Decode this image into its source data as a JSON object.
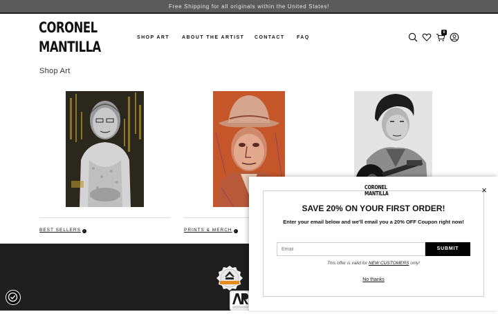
{
  "announcement": "Free Shipping for all originals within the United States!",
  "logo": {
    "line1": "CORONEL",
    "line2": "MANTILLA"
  },
  "nav": [
    {
      "label": "SHOP ART"
    },
    {
      "label": "ABOUT THE ARTIST"
    },
    {
      "label": "CONTACT"
    },
    {
      "label": "FAQ"
    }
  ],
  "header_icons": [
    "search-icon",
    "heart-icon",
    "cart-icon",
    "account-icon"
  ],
  "cart_count": "0",
  "page_title": "Shop Art",
  "categories": [
    {
      "label": "BEST SELLERS"
    },
    {
      "label": "PRINTS & MERCH"
    }
  ],
  "popup": {
    "logo_line1": "CORONEL",
    "logo_line2": "MANTILLA",
    "title": "SAVE 20% ON YOUR FIRST ORDER!",
    "description": "Enter your email below and we'll email you a 20% OFF Coupon right now!",
    "email_placeholder": "Email",
    "submit_label": "SUBMIT",
    "note_before": "This offer is valid for ",
    "note_link": "NEW CUSTOMERS",
    "note_after": " only!",
    "no_thanks": "No thanks",
    "close_symbol": "×"
  },
  "colors": {
    "announce_bg": "#5b5b5b",
    "footer_bg": "#1e1e1e",
    "submit_bg": "#000000"
  }
}
